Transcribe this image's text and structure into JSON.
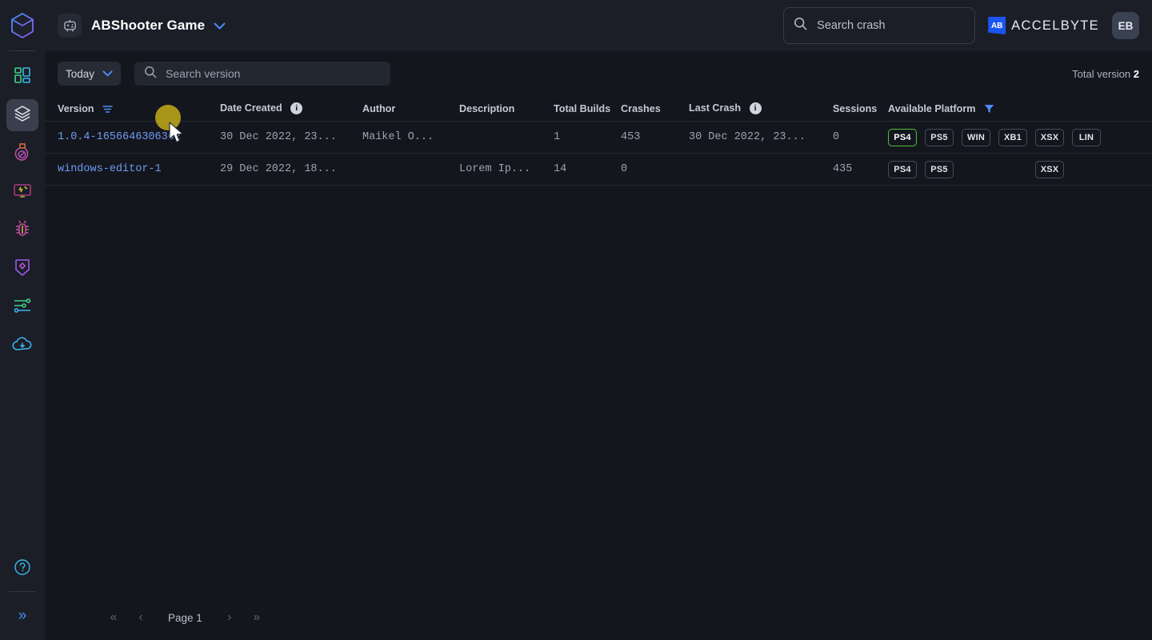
{
  "colors": {
    "bg": "#14161d",
    "panel": "#1b1e26",
    "accent_blue": "#4b8df8",
    "link_blue": "#6d9bf2",
    "platform_active_green": "#4ec13b",
    "brand_blue": "#1a55f0",
    "click_highlight": "#cbb11a"
  },
  "sidebar": {
    "logo_icon": "cube-logo-icon",
    "items": [
      {
        "icon": "dashboard-grid-icon",
        "name": "sidebar-item-dashboard",
        "active": false
      },
      {
        "icon": "layers-stack-icon",
        "name": "sidebar-item-builds",
        "active": true
      },
      {
        "icon": "potion-flask-icon",
        "name": "sidebar-item-potion",
        "active": false
      },
      {
        "icon": "monitor-crash-icon",
        "name": "sidebar-item-crash-monitor",
        "active": false
      },
      {
        "icon": "bug-icon",
        "name": "sidebar-item-bugs",
        "active": false
      },
      {
        "icon": "badge-diamond-icon",
        "name": "sidebar-item-achievements",
        "active": false
      },
      {
        "icon": "sliders-settings-icon",
        "name": "sidebar-item-settings",
        "active": false
      },
      {
        "icon": "cloud-download-icon",
        "name": "sidebar-item-downloads",
        "active": false
      }
    ],
    "help_icon": "question-circle-icon",
    "expand_icon": "chevron-double-right-icon"
  },
  "topbar": {
    "game_icon": "robot-game-icon",
    "game_title": "ABShooter Game",
    "game_dropdown_icon": "chevron-down-icon",
    "search_crash": {
      "icon": "search-icon",
      "placeholder": "Search crash",
      "value": ""
    },
    "brand_name": "ACCELBYTE",
    "brand_mark_text": "AB",
    "avatar_initials": "EB"
  },
  "filterbar": {
    "date_filter_label": "Today",
    "date_filter_icon": "chevron-down-icon",
    "search_version": {
      "icon": "search-icon",
      "placeholder": "Search version",
      "value": ""
    },
    "total_label": "Total version",
    "total_count": "2"
  },
  "table": {
    "columns": [
      {
        "label": "Version",
        "icon": "sort-filter-icon",
        "name": "column-header-version"
      },
      {
        "label": "Date Created",
        "icon": "info-icon",
        "name": "column-header-date-created"
      },
      {
        "label": "Author",
        "icon": "",
        "name": "column-header-author"
      },
      {
        "label": "Description",
        "icon": "",
        "name": "column-header-description"
      },
      {
        "label": "Total Builds",
        "icon": "",
        "name": "column-header-total-builds"
      },
      {
        "label": "Crashes",
        "icon": "",
        "name": "column-header-crashes"
      },
      {
        "label": "Last Crash",
        "icon": "info-icon",
        "name": "column-header-last-crash"
      },
      {
        "label": "Sessions",
        "icon": "",
        "name": "column-header-sessions"
      },
      {
        "label": "Available Platform",
        "icon": "filter-funnel-icon",
        "name": "column-header-available-platform"
      }
    ],
    "platform_order": [
      "PS4",
      "PS5",
      "WIN",
      "XB1",
      "XSX",
      "LIN"
    ],
    "rows": [
      {
        "version": "1.0.4-1656646306362",
        "date_created": "30 Dec 2022, 23...",
        "author": "Maikel O...",
        "description": "",
        "total_builds": "1",
        "crashes": "453",
        "last_crash": "30 Dec 2022, 23...",
        "sessions": "0",
        "platforms": [
          {
            "label": "PS4",
            "active": true
          },
          {
            "label": "PS5",
            "active": false
          },
          {
            "label": "WIN",
            "active": false
          },
          {
            "label": "XB1",
            "active": false
          },
          {
            "label": "XSX",
            "active": false
          },
          {
            "label": "LIN",
            "active": false
          }
        ]
      },
      {
        "version": "windows-editor-1",
        "date_created": "29 Dec 2022, 18...",
        "author": "",
        "description": "Lorem Ip...",
        "total_builds": "14",
        "crashes": "0",
        "last_crash": "",
        "sessions": "435",
        "platforms": [
          {
            "label": "PS4",
            "active": false
          },
          {
            "label": "PS5",
            "active": false
          },
          {
            "label": "",
            "active": false
          },
          {
            "label": "",
            "active": false
          },
          {
            "label": "XSX",
            "active": false
          },
          {
            "label": "",
            "active": false
          }
        ]
      }
    ]
  },
  "pagination": {
    "first_icon": "chevron-double-left-icon",
    "prev_icon": "chevron-left-icon",
    "page_label": "Page 1",
    "next_icon": "chevron-right-icon",
    "last_icon": "chevron-double-right-icon"
  }
}
